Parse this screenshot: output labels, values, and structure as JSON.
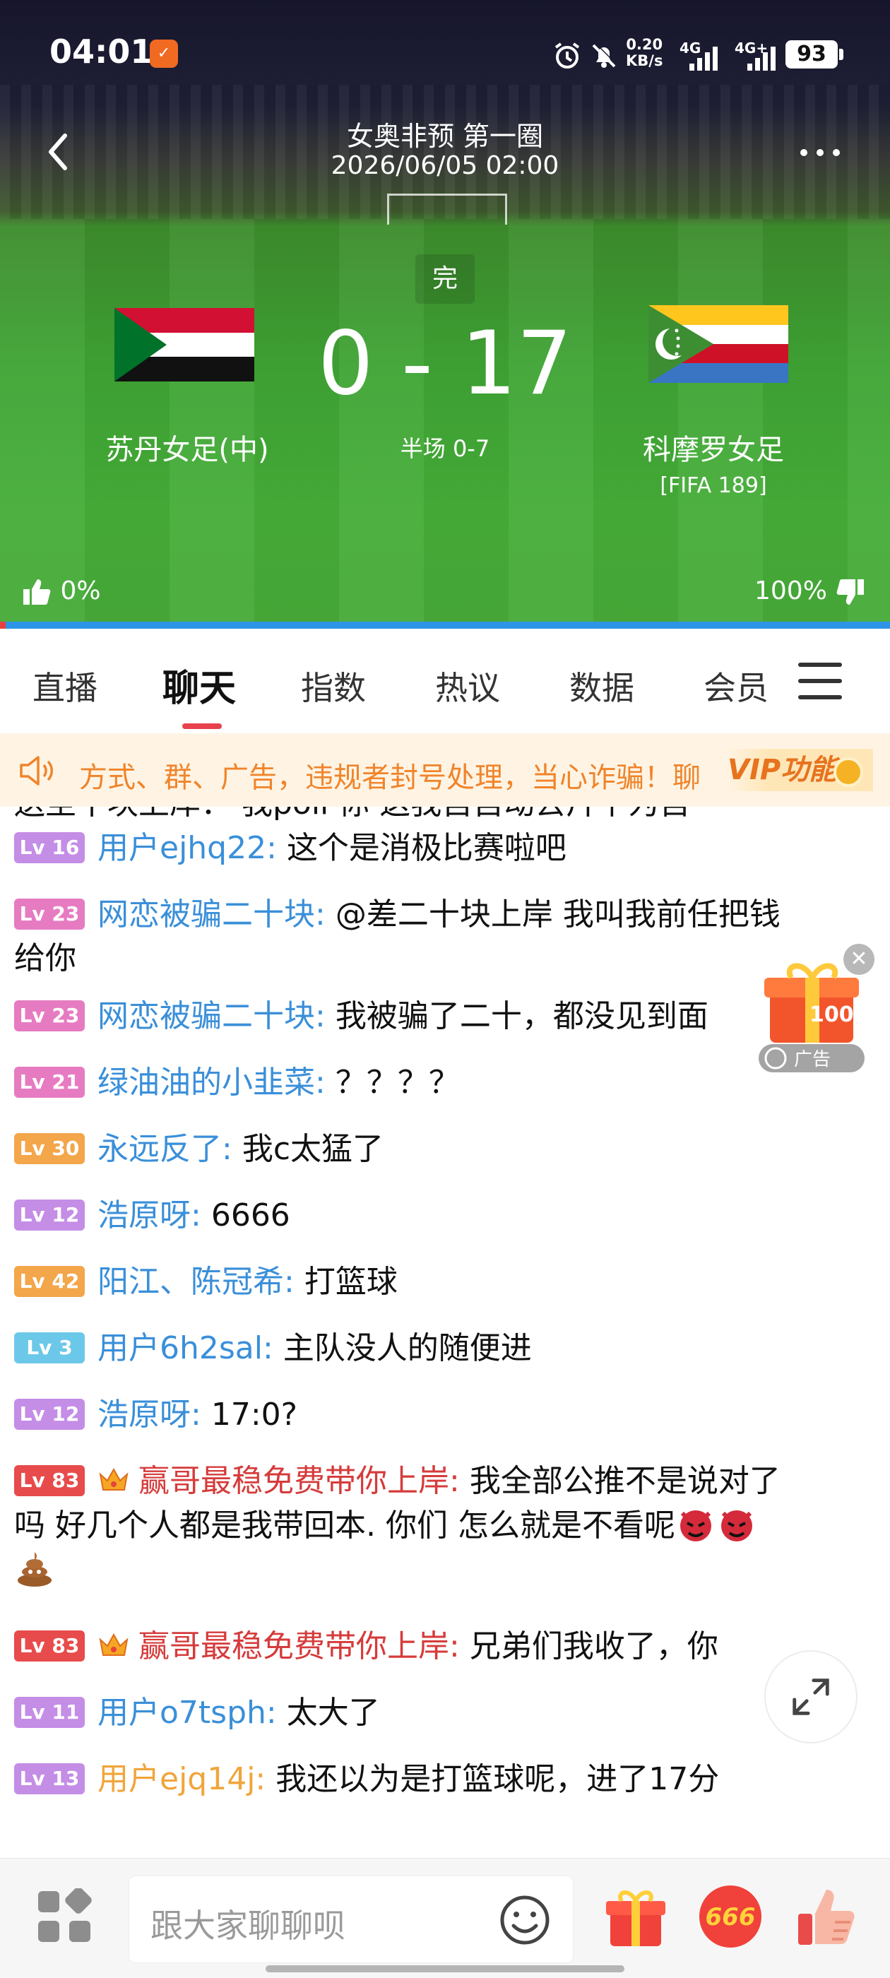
{
  "status_bar": {
    "time": "04:01",
    "app_badge": "✓",
    "net_speed_value": "0.20",
    "net_speed_unit": "KB/s",
    "network_1": "4G",
    "network_2": "4G+",
    "battery": "93"
  },
  "header": {
    "title": "女奥非预 第一圈",
    "datetime": "2026/06/05 02:00",
    "more_label": "•••"
  },
  "match": {
    "state": "完",
    "home_team": "苏丹女足(中)",
    "away_team": "科摩罗女足",
    "away_rank": "[FIFA 189]",
    "score": "0 - 17",
    "halftime": "半场 0-7",
    "home_support": "0%",
    "away_support": "100%",
    "home_support_fraction": 0.0,
    "away_support_fraction": 1.0
  },
  "tabs": [
    {
      "label": "直播"
    },
    {
      "label": "聊天"
    },
    {
      "label": "指数"
    },
    {
      "label": "热议"
    },
    {
      "label": "数据"
    },
    {
      "label": "会员"
    }
  ],
  "notice": {
    "text": "方式、群、广告，违规者封号处理，当心诈骗！聊",
    "vip_label": "VIP功能"
  },
  "chat": {
    "partial_top": "送至十块上岸：  我poli 你 这我自自动去片下为自",
    "messages": [
      {
        "level": "Lv 16",
        "level_color": "#c48de6",
        "nick": "用户ejhq22:",
        "text": "这个是消极比赛啦吧"
      },
      {
        "level": "Lv 23",
        "level_color": "#e67bc2",
        "nick": "网恋被骗二十块:",
        "text": "@差二十块上岸 我叫我前任把钱",
        "text2": "给你"
      },
      {
        "level": "Lv 23",
        "level_color": "#e67bc2",
        "nick": "网恋被骗二十块:",
        "text": "我被骗了二十，都没见到面"
      },
      {
        "level": "Lv 21",
        "level_color": "#e67bc2",
        "nick": "绿油油的小韭菜:",
        "text": "？？？？"
      },
      {
        "level": "Lv 30",
        "level_color": "#f3a64a",
        "nick": "永远反了:",
        "text": "我c太猛了"
      },
      {
        "level": "Lv 12",
        "level_color": "#c48de6",
        "nick": "浩原呀:",
        "text": "6666"
      },
      {
        "level": "Lv 42",
        "level_color": "#f3a64a",
        "nick": "阳江、陈冠希:",
        "text": "打篮球"
      },
      {
        "level": "Lv 3",
        "level_color": "#6cc8e8",
        "nick": "用户6h2sal:",
        "text": "主队没人的随便进"
      },
      {
        "level": "Lv 12",
        "level_color": "#c48de6",
        "nick": "浩原呀:",
        "text": "17:0?"
      },
      {
        "level": "Lv 83",
        "level_color": "#e84b4b",
        "nick": "赢哥最稳免费带你上岸:",
        "text": "我全部公推不是说对了",
        "text2": "吗 好几个人都是我带回本. 你们 怎么就是不看呢"
      },
      {
        "level": "Lv 83",
        "level_color": "#e84b4b",
        "nick": "赢哥最稳免费带你上岸:",
        "text": "兄弟们我收了，你"
      },
      {
        "level": "Lv 11",
        "level_color": "#c48de6",
        "nick": "用户o7tsph:",
        "text": "太大了"
      },
      {
        "level": "Lv 13",
        "level_color": "#c48de6",
        "nick": "用户ejq14j:",
        "text": "我还以为是打篮球呢，进了17分"
      }
    ]
  },
  "gift_float": {
    "badge": "100",
    "ad_label": "广告"
  },
  "input_bar": {
    "placeholder": "跟大家聊聊呗",
    "btn_666": "666"
  },
  "icons": {
    "back": "back-chevron",
    "more": "more-dots",
    "menu": "hamburger",
    "speaker": "speaker-icon",
    "gift": "gift-icon",
    "like": "thumbs-up-icon",
    "emoji": "smile-icon",
    "grid": "apps-grid-icon",
    "expand": "expand-icon"
  }
}
